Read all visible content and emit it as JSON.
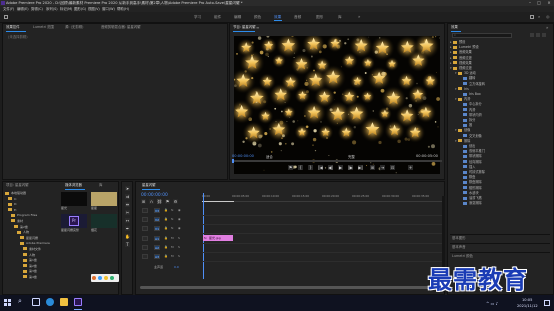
{
  "titlebar": {
    "title": "Adobe Premiere Pro 2020 - D:\\回顾\\最新素材 Premiere Pro 2020 从新手到高手\\素材\\第2章\\人物\\Adobe Premiere Pro Auto-Save\\星星闪耀 *"
  },
  "menu": [
    "文件(F)",
    "编辑(E)",
    "剪辑(C)",
    "序列(S)",
    "标记(M)",
    "图形(G)",
    "视图(V)",
    "窗口(W)",
    "帮助(H)"
  ],
  "workspaces": [
    "学习",
    "组件",
    "编辑",
    "颜色",
    "效果",
    "音频",
    "图形",
    "库"
  ],
  "source_panel": {
    "tabs": [
      "效果控件",
      "Lumetri 范围",
      "源: (无剪辑)",
      "音频剪辑混合器: 星星闪耀"
    ],
    "empty": "(未选择剪辑)"
  },
  "program_monitor": {
    "tab": "节目: 星星闪耀",
    "timecode_left": "00:00:00:00",
    "fit": "适合",
    "quality": "完整",
    "timecode_right": "00:00:05:00",
    "transport": [
      "⚑",
      "{",
      "}",
      "|◀",
      "◀|",
      "▶",
      "|▶",
      "▶|",
      "⊞",
      "⇥",
      "⊡",
      "+"
    ]
  },
  "effects_panel": {
    "tab": "效果",
    "search_placeholder": "",
    "items": [
      {
        "label": "预设",
        "kind": "folder",
        "depth": 0,
        "open": false
      },
      {
        "label": "Lumetri 预设",
        "kind": "folder",
        "depth": 0,
        "open": false
      },
      {
        "label": "音频效果",
        "kind": "folder",
        "depth": 0,
        "open": false
      },
      {
        "label": "音频过渡",
        "kind": "folder",
        "depth": 0,
        "open": false
      },
      {
        "label": "视频效果",
        "kind": "folder",
        "depth": 0,
        "open": false
      },
      {
        "label": "视频过渡",
        "kind": "folder",
        "depth": 0,
        "open": true
      },
      {
        "label": "3D 运动",
        "kind": "folder",
        "depth": 1,
        "open": true
      },
      {
        "label": "翻转",
        "kind": "fx",
        "depth": 2
      },
      {
        "label": "立方体旋转",
        "kind": "fx",
        "depth": 2
      },
      {
        "label": "Iris",
        "kind": "folder",
        "depth": 1,
        "open": true
      },
      {
        "label": "Iris Box",
        "kind": "fx",
        "depth": 2
      },
      {
        "label": "内滑",
        "kind": "folder",
        "depth": 1,
        "open": true
      },
      {
        "label": "中心拆分",
        "kind": "fx",
        "depth": 2
      },
      {
        "label": "内滑",
        "kind": "fx",
        "depth": 2
      },
      {
        "label": "带状内滑",
        "kind": "fx",
        "depth": 2
      },
      {
        "label": "拆分",
        "kind": "fx",
        "depth": 2
      },
      {
        "label": "推",
        "kind": "fx",
        "depth": 2
      },
      {
        "label": "划像",
        "kind": "folder",
        "depth": 1,
        "open": true
      },
      {
        "label": "交叉划像",
        "kind": "fx",
        "depth": 2
      },
      {
        "label": "擦除",
        "kind": "folder",
        "depth": 1,
        "open": true
      },
      {
        "label": "划出",
        "kind": "fx",
        "depth": 2
      },
      {
        "label": "双侧平推门",
        "kind": "fx",
        "depth": 2
      },
      {
        "label": "带状擦除",
        "kind": "fx",
        "depth": 2
      },
      {
        "label": "径向擦除",
        "kind": "fx",
        "depth": 2
      },
      {
        "label": "插入",
        "kind": "fx",
        "depth": 2
      },
      {
        "label": "时钟式擦除",
        "kind": "fx",
        "depth": 2
      },
      {
        "label": "棋盘",
        "kind": "fx",
        "depth": 2
      },
      {
        "label": "棋盘擦除",
        "kind": "fx",
        "depth": 2
      },
      {
        "label": "楔形擦除",
        "kind": "fx",
        "depth": 2
      },
      {
        "label": "水波块",
        "kind": "fx",
        "depth": 2
      },
      {
        "label": "油漆飞溅",
        "kind": "fx",
        "depth": 2
      },
      {
        "label": "渐变擦除",
        "kind": "fx",
        "depth": 2
      }
    ],
    "bottom_sections": [
      "基本图形",
      "基本声音",
      "Lumetri 颜色"
    ]
  },
  "project_panel": {
    "tabs": [
      "项目: 星星闪耀",
      "媒体浏览器",
      "库"
    ],
    "tree": [
      "本地驱动器",
      "C:",
      "D:",
      "E:",
      "Program Files",
      "素材",
      "第2章",
      "人物",
      "星星闪耀",
      "Adobe Premiere",
      "素材文件",
      "人物",
      "第1章",
      "第2章",
      "第3章",
      "第4章"
    ],
    "thumbs": [
      {
        "label": "星光",
        "color": "#0b0b0b"
      },
      {
        "label": "星星",
        "color": "#b9a468"
      },
      {
        "label": "星星闪耀完整",
        "color": "#1b1b35"
      },
      {
        "label": "烟花",
        "color": "#17302a"
      }
    ]
  },
  "timeline": {
    "tab": "星星闪耀",
    "timecode": "00:00:00:00",
    "ruler": [
      "00:00",
      "00:00:05:00",
      "00:00:10:00",
      "00:00:15:00",
      "00:00:20:00",
      "00:00:25:00",
      "00:00:30:00",
      "00:00:35:00"
    ],
    "video_tracks": [
      "V3",
      "V2",
      "V1"
    ],
    "audio_tracks": [
      "A1",
      "A2",
      "A3"
    ],
    "master": "主声道",
    "master_value": "0.0",
    "clip": {
      "label": "星光.jpg",
      "color": "#e07ee0"
    }
  },
  "watermark": "最需教育",
  "taskbar": {
    "time": "10:05",
    "date": "2021/11/12"
  }
}
